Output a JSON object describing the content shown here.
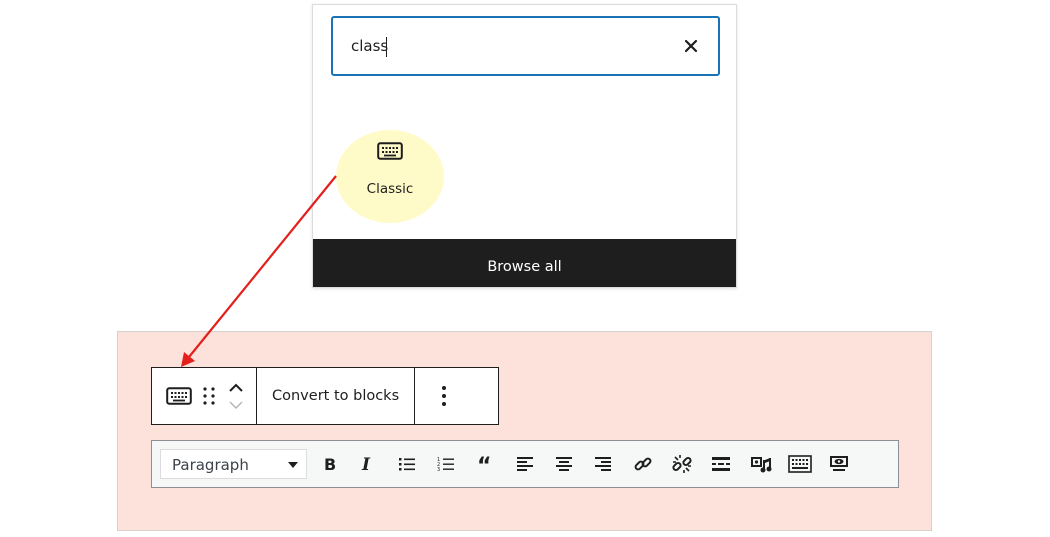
{
  "inserter": {
    "search": {
      "value": "class",
      "placeholder": ""
    },
    "result": {
      "label": "Classic",
      "icon": "keyboard-icon"
    },
    "browse_all_label": "Browse all",
    "highlight_color": "#fffbc8"
  },
  "annotation": {
    "arrow_color": "#e3201b"
  },
  "block_toolbar": {
    "block_icon": "keyboard-icon",
    "drag_icon": "drag-handle-icon",
    "move_up_icon": "chevron-up-icon",
    "move_down_icon": "chevron-down-icon",
    "convert_label": "Convert to blocks",
    "more_icon": "more-vertical-icon"
  },
  "classic_toolbar": {
    "format_select": "Paragraph",
    "buttons": [
      "bold",
      "italic",
      "bulleted-list",
      "numbered-list",
      "blockquote",
      "align-left",
      "align-center",
      "align-right",
      "insert-link",
      "remove-link",
      "read-more",
      "add-media",
      "toolbar-toggle",
      "preview"
    ]
  },
  "colors": {
    "canvas_bg": "#fde2dc",
    "accent": "#1a73b5",
    "dark": "#1e1e1e"
  }
}
